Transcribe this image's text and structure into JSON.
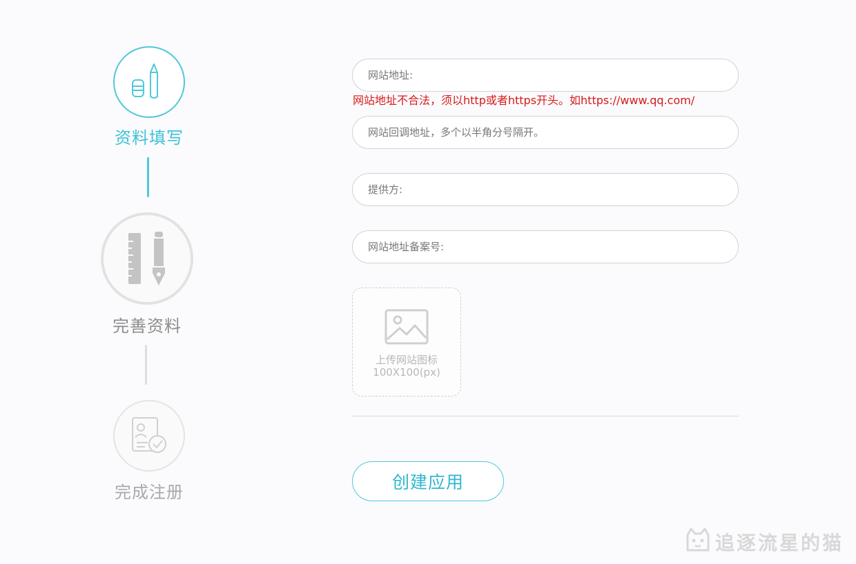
{
  "steps": [
    {
      "label": "资料填写",
      "state": "active",
      "icon": "pen-eraser-icon"
    },
    {
      "label": "完善资料",
      "state": "pending",
      "icon": "ruler-pen-icon"
    },
    {
      "label": "完成注册",
      "state": "pending",
      "icon": "document-check-icon"
    }
  ],
  "colors": {
    "accent": "#4ec8d8",
    "error": "#d61b1b",
    "inactive": "#dcdcdc"
  },
  "form": {
    "url_placeholder": "网站地址:",
    "url_error": "网站地址不合法，须以http或者https开头。如https://www.qq.com/",
    "callback_placeholder": "网站回调地址，多个以半角分号隔开。",
    "provider_placeholder": "提供方:",
    "icp_placeholder": "网站地址备案号:",
    "upload_title": "上传网站图标",
    "upload_size": "100X100(px)",
    "submit_label": "创建应用"
  },
  "watermark": {
    "text": "追逐流星的猫"
  }
}
